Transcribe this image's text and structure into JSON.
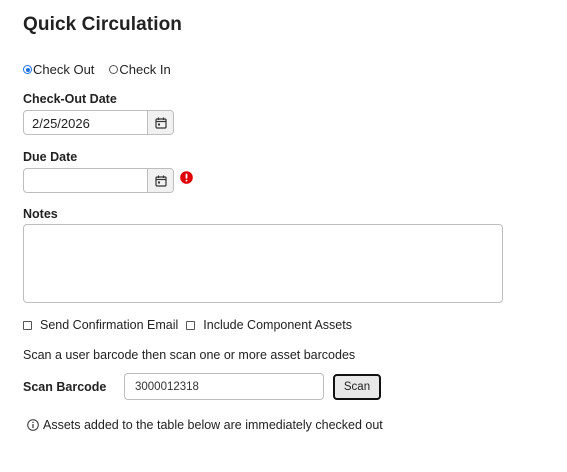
{
  "page": {
    "title": "Quick Circulation"
  },
  "mode": {
    "options": [
      {
        "label": "Check Out",
        "selected": true
      },
      {
        "label": "Check In",
        "selected": false
      }
    ]
  },
  "checkout_date": {
    "label": "Check-Out Date",
    "value": "2/25/2026"
  },
  "due_date": {
    "label": "Due Date",
    "value": "",
    "error_icon": "exclamation-circle-icon",
    "error_color": "#e00000"
  },
  "notes": {
    "label": "Notes",
    "value": ""
  },
  "options": {
    "send_email_label": "Send Confirmation Email",
    "include_components_label": "Include Component Assets"
  },
  "hint": "Scan a user barcode then scan one or more asset barcodes",
  "scan": {
    "label": "Scan Barcode",
    "value": "3000012318",
    "button_label": "Scan"
  },
  "info": {
    "text": "Assets added to the table below are immediately checked out",
    "icon": "info-circle-icon"
  }
}
